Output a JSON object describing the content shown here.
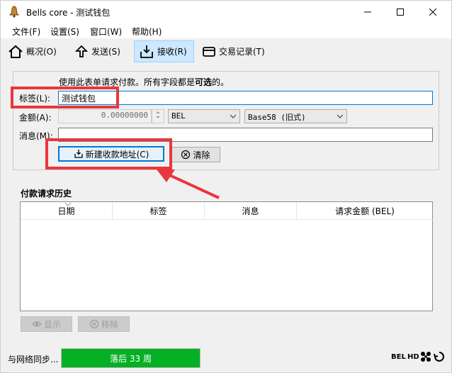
{
  "window": {
    "title": "Bells core - 测试钱包"
  },
  "menu": [
    "文件(F)",
    "设置(S)",
    "窗口(W)",
    "帮助(H)"
  ],
  "tabs": [
    {
      "label": "概况(O)",
      "icon": "home-icon"
    },
    {
      "label": "发送(S)",
      "icon": "send-icon"
    },
    {
      "label": "接收(R)",
      "icon": "receive-icon",
      "active": true
    },
    {
      "label": "交易记录(T)",
      "icon": "transactions-icon"
    }
  ],
  "form": {
    "note_prefix": "使用此表单请求付款。所有字段都是",
    "note_bold": "可选",
    "note_suffix": "的。",
    "label_field_label": "标签(L):",
    "label_value": "测试钱包",
    "amount_field_label": "金额(A):",
    "amount_value": "0.00000000",
    "unit_value": "BEL",
    "address_type_value": "Base58 (旧式)",
    "message_field_label": "消息(M):",
    "message_value": "",
    "new_address_button": "新建收款地址(C)",
    "clear_button": "清除"
  },
  "history": {
    "title": "付款请求历史",
    "columns": [
      "日期",
      "标签",
      "消息",
      "请求金额 (BEL)"
    ],
    "show_button": "显示",
    "remove_button": "移除"
  },
  "status": {
    "sync_text": "与网络同步...",
    "progress_text": "落后 33 周",
    "progress_fraction": 1.0,
    "unit": "BEL",
    "hd": "HD"
  },
  "annotation_color": "#e8373d"
}
